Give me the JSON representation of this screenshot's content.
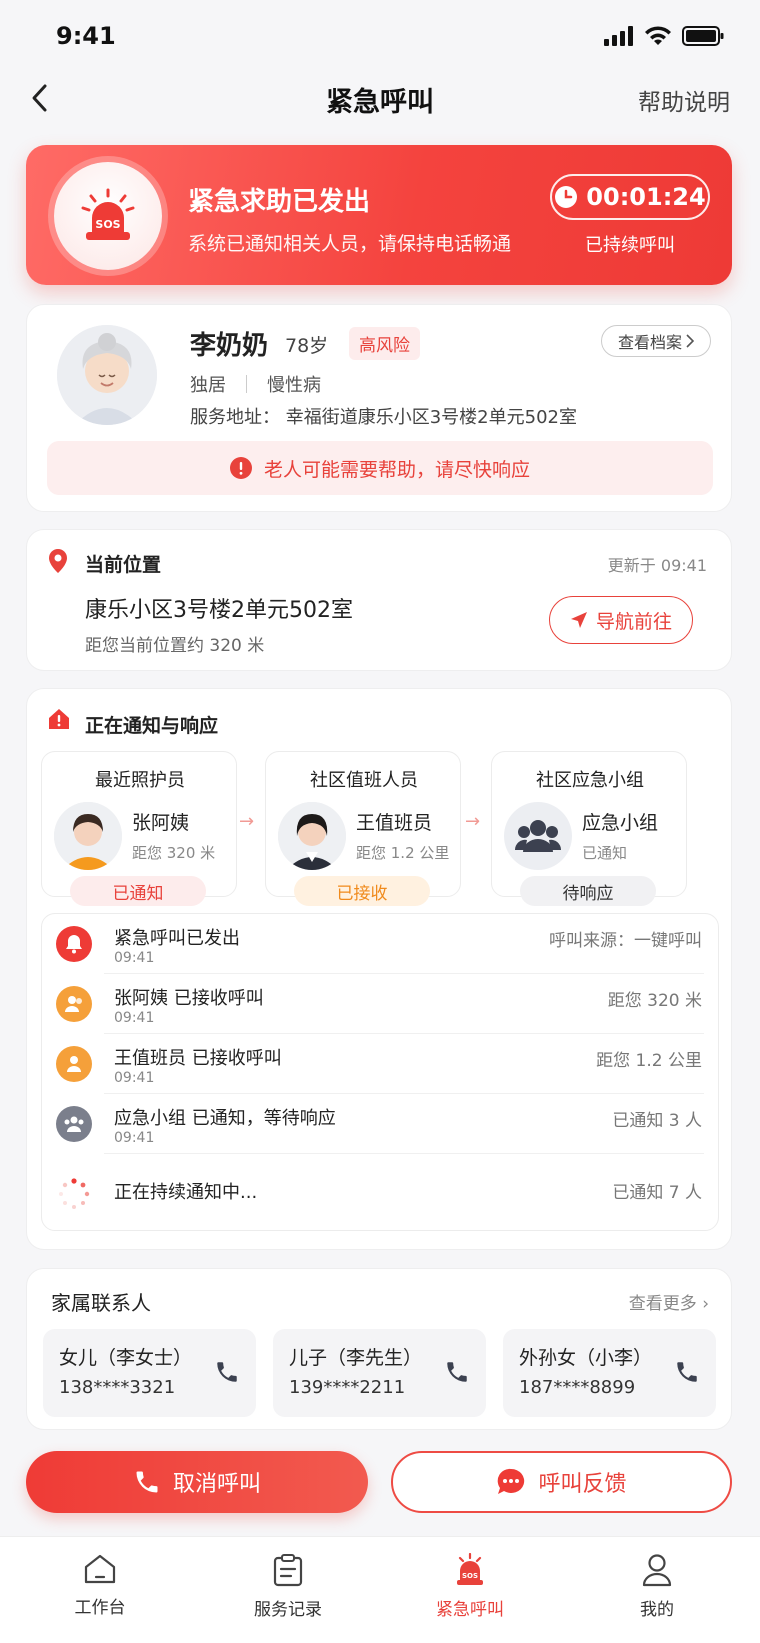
{
  "status_bar": {
    "time": "9:41"
  },
  "nav": {
    "title": "紧急呼叫",
    "help": "帮助说明"
  },
  "banner": {
    "title": "紧急求助已发出",
    "subtitle": "系统已通知相关人员，请保持电话畅通",
    "timer": "00:01:24",
    "timer_label": "已持续呼叫",
    "icon": "sos-alarm-icon"
  },
  "elder": {
    "name": "李奶奶",
    "age": "78岁",
    "risk": "高风险",
    "view_file": "查看档案",
    "tags": [
      "独居",
      "慢性病"
    ],
    "address": "服务地址：   幸福街道康乐小区3号楼2单元502室",
    "alert": "老人可能需要帮助，请尽快响应"
  },
  "location": {
    "title": "当前位置",
    "updated": "更新于 09:41",
    "address": "康乐小区3号楼2单元502室",
    "distance": "距您当前位置约 320 米",
    "nav_button": "导航前往"
  },
  "notify": {
    "title": "正在通知与响应",
    "responders": [
      {
        "role": "最近照护员",
        "name": "张阿姨",
        "distance": "距您 320 米",
        "status": "已通知",
        "status_color": "#e8423b",
        "status_bg": "#fdecec"
      },
      {
        "role": "社区值班人员",
        "name": "王值班员",
        "distance": "距您 1.2 公里",
        "status": "已接收",
        "status_color": "#f08a1c",
        "status_bg": "#fff1e0"
      },
      {
        "role": "社区应急小组",
        "name": "应急小组",
        "distance": "已通知",
        "status": "待响应",
        "status_color": "#333333",
        "status_bg": "#f1f1f3"
      }
    ],
    "timeline": [
      {
        "text": "紧急呼叫已发出",
        "time": "09:41",
        "right": "呼叫来源：一键呼叫",
        "icon": "bell-icon",
        "color": "#ee3b36"
      },
      {
        "text": "张阿姨 已接收呼叫",
        "time": "09:41",
        "right": "距您 320 米",
        "icon": "user-group-icon",
        "color": "#f5a03a"
      },
      {
        "text": "王值班员 已接收呼叫",
        "time": "09:41",
        "right": "距您 1.2 公里",
        "icon": "user-icon",
        "color": "#f5a03a"
      },
      {
        "text": "应急小组 已通知，等待响应",
        "time": "09:41",
        "right": "已通知 3 人",
        "icon": "group-icon",
        "color": "#7b7f8c"
      },
      {
        "text": "正在持续通知中...",
        "time": "",
        "right": "已通知 7 人",
        "icon": "loading-icon",
        "color": "#ee3b36"
      }
    ]
  },
  "family": {
    "title": "家属联系人",
    "more": "查看更多",
    "contacts": [
      {
        "name": "女儿（李女士）",
        "phone": "138****3321"
      },
      {
        "name": "儿子（李先生）",
        "phone": "139****2211"
      },
      {
        "name": "外孙女（小李）",
        "phone": "187****8899"
      }
    ]
  },
  "actions": {
    "cancel": "取消呼叫",
    "feedback": "呼叫反馈"
  },
  "tabs": [
    {
      "label": "工作台",
      "icon": "home-icon"
    },
    {
      "label": "服务记录",
      "icon": "clipboard-icon"
    },
    {
      "label": "紧急呼叫",
      "icon": "sos-icon"
    },
    {
      "label": "我的",
      "icon": "profile-icon"
    }
  ],
  "colors": {
    "accent": "#e8423b",
    "warning": "#f08a1c"
  }
}
